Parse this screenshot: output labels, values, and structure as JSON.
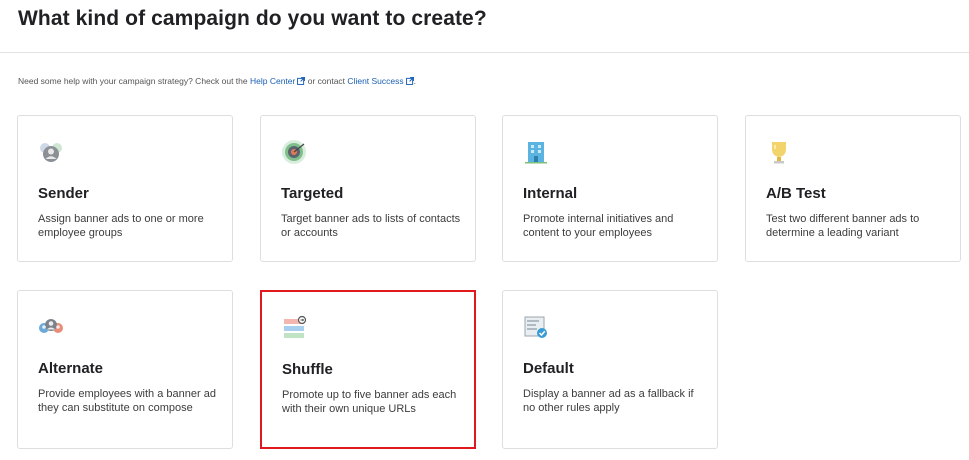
{
  "header": {
    "title": "What kind of campaign do you want to create?"
  },
  "help": {
    "prefix": "Need some help with your campaign strategy? Check out the ",
    "help_center": "Help Center",
    "middle": " or contact ",
    "client_success": "Client Success",
    "suffix": "."
  },
  "cards": [
    {
      "title": "Sender",
      "description": "Assign banner ads to one or more employee groups",
      "icon": "people-group-icon"
    },
    {
      "title": "Targeted",
      "description": "Target banner ads to lists of contacts or accounts",
      "icon": "target-icon"
    },
    {
      "title": "Internal",
      "description": "Promote internal initiatives and content to your employees",
      "icon": "building-icon"
    },
    {
      "title": "A/B Test",
      "description": "Test two different banner ads to determine a leading variant",
      "icon": "trophy-icon"
    },
    {
      "title": "Alternate",
      "description": "Provide employees with a banner ad they can substitute on compose",
      "icon": "alternate-people-icon"
    },
    {
      "title": "Shuffle",
      "description": "Promote up to five banner ads each with their own unique URLs",
      "icon": "shuffle-banners-icon",
      "selected": true
    },
    {
      "title": "Default",
      "description": "Display a banner ad as a fallback if no other rules apply",
      "icon": "default-check-icon"
    }
  ],
  "colors": {
    "link": "#1a5fb4",
    "selection_border": "#e0191e",
    "card_border": "#dedede"
  }
}
